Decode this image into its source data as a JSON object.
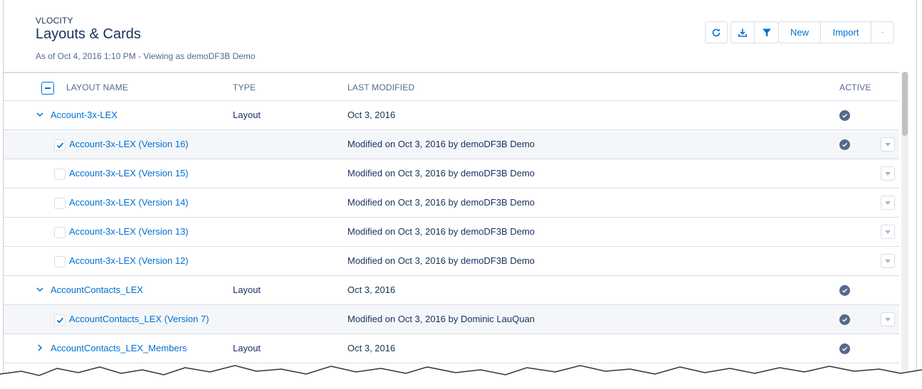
{
  "header": {
    "object_label": "VLOCITY",
    "title": "Layouts & Cards",
    "meta": "As of Oct 4, 2016 1:10 PM - Viewing as demoDF3B Demo"
  },
  "toolbar": {
    "refresh_icon": "refresh-icon",
    "download_icon": "download-icon",
    "filter_icon": "filter-icon",
    "new_label": "New",
    "import_label": "Import",
    "more_icon": "chevron-down-icon"
  },
  "columns": {
    "name": "LAYOUT NAME",
    "type": "TYPE",
    "modified": "LAST MODIFIED",
    "active": "ACTIVE"
  },
  "rows": [
    {
      "kind": "layout",
      "expanded": true,
      "name": "Account-3x-LEX",
      "type": "Layout",
      "modified": "Oct 3, 2016",
      "active": true
    },
    {
      "kind": "version",
      "checked": true,
      "name": "Account-3x-LEX (Version 16)",
      "modified": "Modified on Oct 3, 2016 by demoDF3B Demo",
      "active": true
    },
    {
      "kind": "version",
      "checked": false,
      "name": "Account-3x-LEX (Version 15)",
      "modified": "Modified on Oct 3, 2016 by demoDF3B Demo",
      "active": false
    },
    {
      "kind": "version",
      "checked": false,
      "name": "Account-3x-LEX (Version 14)",
      "modified": "Modified on Oct 3, 2016 by demoDF3B Demo",
      "active": false
    },
    {
      "kind": "version",
      "checked": false,
      "name": "Account-3x-LEX (Version 13)",
      "modified": "Modified on Oct 3, 2016 by demoDF3B Demo",
      "active": false
    },
    {
      "kind": "version",
      "checked": false,
      "name": "Account-3x-LEX (Version 12)",
      "modified": "Modified on Oct 3, 2016 by demoDF3B Demo",
      "active": false
    },
    {
      "kind": "layout",
      "expanded": true,
      "name": "AccountContacts_LEX",
      "type": "Layout",
      "modified": "Oct 3, 2016",
      "active": true
    },
    {
      "kind": "version",
      "checked": true,
      "name": "AccountContacts_LEX (Version 7)",
      "modified": "Modified on Oct 3, 2016 by Dominic LauQuan",
      "active": true
    },
    {
      "kind": "layout",
      "expanded": false,
      "name": "AccountContacts_LEX_Members",
      "type": "Layout",
      "modified": "Oct 3, 2016",
      "active": true
    }
  ],
  "colors": {
    "link": "#0070d2",
    "text": "#16325c",
    "muted": "#54698d",
    "border": "#d8dde6",
    "selected_row": "#f4f6f9"
  }
}
